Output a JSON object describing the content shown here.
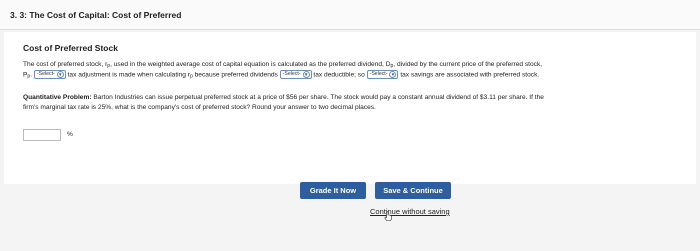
{
  "header": {
    "title": "3. 3: The Cost of Capital: Cost of Preferred"
  },
  "section": {
    "title": "Cost of Preferred Stock"
  },
  "para1": {
    "part1": "The cost of preferred stock, r",
    "rp_sub": "p",
    "part2": ", used in the weighted average cost of capital equation is calculated as the preferred dividend, D",
    "dp_sub": "p",
    "part3": ", divided by the current price of the preferred stock,",
    "line2_p": "P",
    "line2_p_sub": "p",
    "line2_dot": ".",
    "select1": "-Select-",
    "part4": "tax adjustment is made when calculating r",
    "rp2_sub": "p",
    "part5": "because preferred dividends",
    "select2": "-Select-",
    "part6": "tax deductible; so",
    "select3": "-Select-",
    "part7": "tax savings are associated with preferred stock."
  },
  "problem": {
    "label": "Quantitative Problem:",
    "line1": "Barton Industries can issue perpetual preferred stock at a price of $56 per share. The stock would pay a constant annual dividend of $3.11 per share. If the",
    "line2": "firm's marginal tax rate is 25%, what is the company's cost of preferred stock? Round your answer to two decimal places."
  },
  "answer": {
    "value": "",
    "unit": "%"
  },
  "actions": {
    "grade": "Grade It Now",
    "save": "Save & Continue",
    "continue": "Continue without saving"
  },
  "icons": {
    "chevron": "chevron-down-icon",
    "cursor": "hand-cursor-icon"
  },
  "colors": {
    "button": "#2c5ea0",
    "select_border": "#6b8ebd"
  }
}
